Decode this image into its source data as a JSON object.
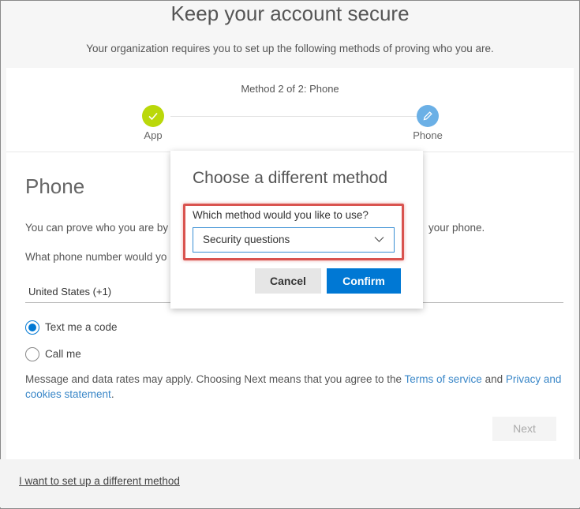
{
  "header": {
    "title": "Keep your account secure",
    "subtitle": "Your organization requires you to set up the following methods of proving who you are."
  },
  "progress": {
    "step_text": "Method 2 of 2: Phone",
    "steps": [
      {
        "label": "App",
        "state": "completed",
        "color": "#bad80a"
      },
      {
        "label": "Phone",
        "state": "current",
        "color": "#6bb0e6"
      }
    ]
  },
  "phone": {
    "heading": "Phone",
    "description_left": "You can prove who you are by",
    "description_right": "your phone.",
    "question_left": "What phone number would yo",
    "country": "United States (+1)",
    "option_text": "Text me a code",
    "option_call": "Call me",
    "terms_prefix": "Message and data rates may apply. Choosing Next means that you agree to the",
    "terms_link": "Terms of service",
    "terms_and": "and",
    "privacy_link": "Privacy and cookies statement",
    "terms_suffix": ".",
    "next_label": "Next"
  },
  "footer": {
    "different_method_link": "I want to set up a different method"
  },
  "dialog": {
    "title": "Choose a different method",
    "question": "Which method would you like to use?",
    "selected_method": "Security questions",
    "cancel_label": "Cancel",
    "confirm_label": "Confirm"
  },
  "colors": {
    "accent": "#0078d4",
    "highlight": "#d9534f",
    "link": "#3a87c8"
  }
}
